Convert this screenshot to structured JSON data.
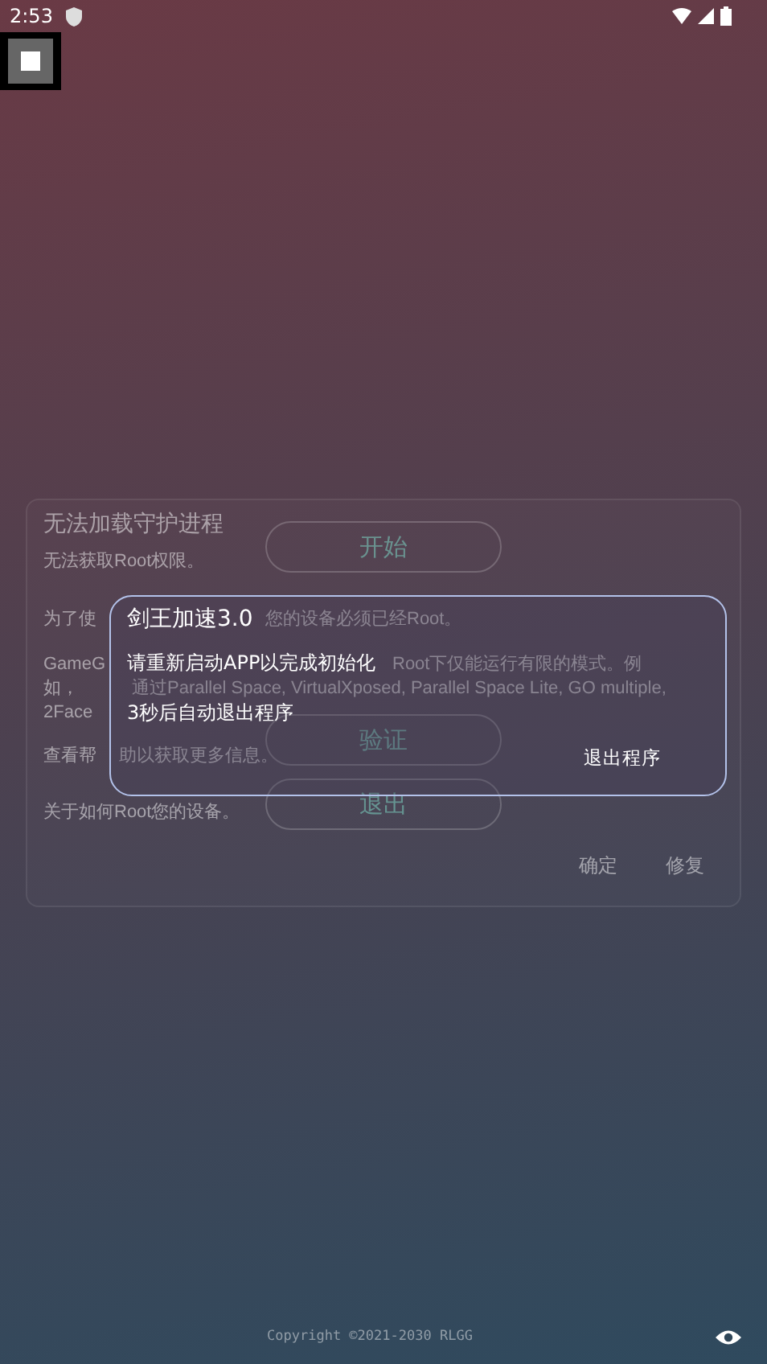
{
  "status_bar": {
    "time": "2:53"
  },
  "card": {
    "title": "无法加载守护进程",
    "paragraphs": [
      {
        "segments": [
          "无法获取Root权限。"
        ]
      },
      {
        "segments": [
          "为了使",
          "您的设备必须已经Root。"
        ]
      },
      {
        "segments": [
          "GameG",
          "Root下仅能运行有限的模式。例"
        ]
      },
      {
        "segments": [
          "如，",
          "通过Parallel Space, VirtualXposed, Parallel Space Lite, GO multiple,"
        ]
      },
      {
        "segments": [
          "2Face"
        ]
      },
      {
        "segments": [
          "查看帮",
          "助以获取更多信息。"
        ]
      },
      {
        "segments": [
          "关于如何Root您的设备。"
        ]
      }
    ],
    "buttons": [
      "开始",
      "验证",
      "退出"
    ],
    "actions": [
      "确定",
      "修复"
    ]
  },
  "dialog": {
    "title": "剑王加速3.0",
    "messages": [
      "请重新启动APP以完成初始化",
      "3秒后自动退出程序"
    ],
    "button": "退出程序"
  },
  "footer": {
    "copyright": "Copyright ©2021-2030 RLGG"
  }
}
